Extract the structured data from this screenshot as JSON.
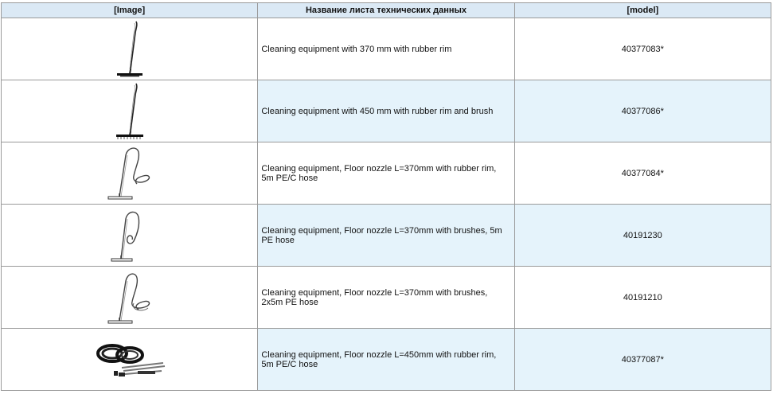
{
  "table": {
    "headers": [
      "[Image]",
      "Название листа технических данных",
      "[model]"
    ],
    "rows": [
      {
        "image_icon": "squeegee-wand-icon",
        "name": "Cleaning equipment with 370 mm with rubber rim",
        "model": "40377083*"
      },
      {
        "image_icon": "squeegee-wand-brush-icon",
        "name": "Cleaning equipment with 450 mm with rubber rim and brush",
        "model": "40377086*"
      },
      {
        "image_icon": "floor-nozzle-hose-icon",
        "name": "Cleaning equipment, Floor nozzle L=370mm with rubber rim, 5m PE/C hose",
        "model": "40377084*"
      },
      {
        "image_icon": "floor-nozzle-coiled-hose-icon",
        "name": "Cleaning equipment, Floor nozzle L=370mm with brushes, 5m PE hose",
        "model": "40191230"
      },
      {
        "image_icon": "floor-nozzle-double-hose-icon",
        "name": "Cleaning equipment, Floor nozzle L=370mm with brushes, 2x5m PE hose",
        "model": "40191210"
      },
      {
        "image_icon": "hose-kit-icon",
        "name": "Cleaning equipment, Floor nozzle L=450mm with rubber rim, 5m PE/C hose",
        "model": "40377087*"
      }
    ]
  }
}
